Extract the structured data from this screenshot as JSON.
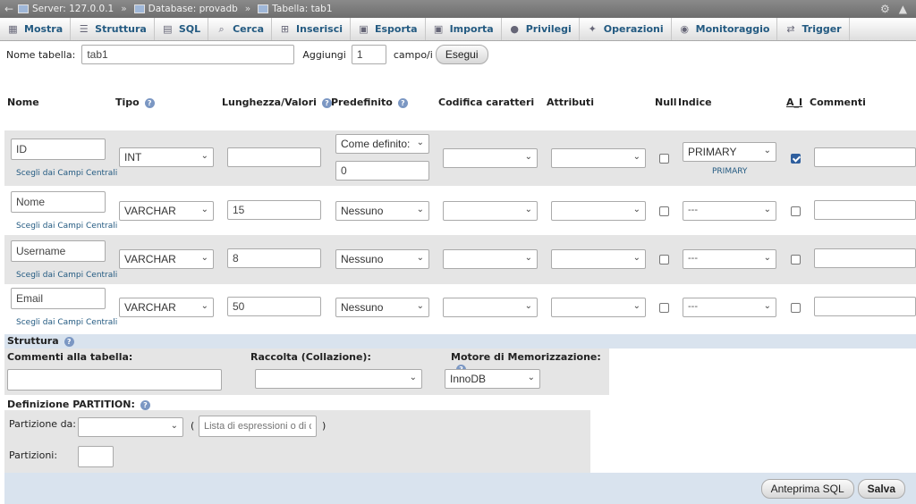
{
  "titlebar": {
    "server": "Server: 127.0.0.1",
    "database": "Database: provadb",
    "table": "Tabella: tab1"
  },
  "tabs": [
    {
      "label": "Mostra",
      "icon": "table-icon"
    },
    {
      "label": "Struttura",
      "icon": "structure-icon"
    },
    {
      "label": "SQL",
      "icon": "sql-icon"
    },
    {
      "label": "Cerca",
      "icon": "search-icon"
    },
    {
      "label": "Inserisci",
      "icon": "insert-icon"
    },
    {
      "label": "Esporta",
      "icon": "export-icon"
    },
    {
      "label": "Importa",
      "icon": "import-icon"
    },
    {
      "label": "Privilegi",
      "icon": "privileges-icon"
    },
    {
      "label": "Operazioni",
      "icon": "wrench-icon"
    },
    {
      "label": "Monitoraggio",
      "icon": "eye-icon"
    },
    {
      "label": "Trigger",
      "icon": "trigger-icon"
    }
  ],
  "namebar": {
    "table_name_label": "Nome tabella:",
    "table_name_value": "tab1",
    "add_label": "Aggiungi",
    "add_value": "1",
    "fields_label": "campo/i",
    "go_button": "Esegui"
  },
  "columns": {
    "name": "Nome",
    "type": "Tipo",
    "length": "Lunghezza/Valori",
    "default": "Predefinito",
    "collation": "Codifica caratteri",
    "attributes": "Attributi",
    "null": "Null",
    "index": "Indice",
    "ai": "A_I",
    "comments": "Commenti"
  },
  "central_columns_link": "Scegli dai Campi Centrali",
  "fields": [
    {
      "name": "ID",
      "type": "INT",
      "length": "",
      "default": "Come definito:",
      "default_value": "0",
      "collation": "",
      "attributes": "",
      "null": false,
      "index": "PRIMARY",
      "index_note": "PRIMARY",
      "ai": true
    },
    {
      "name": "Nome",
      "type": "VARCHAR",
      "length": "15",
      "default": "Nessuno",
      "collation": "",
      "attributes": "",
      "null": false,
      "index": "---",
      "ai": false
    },
    {
      "name": "Username",
      "type": "VARCHAR",
      "length": "8",
      "default": "Nessuno",
      "collation": "",
      "attributes": "",
      "null": false,
      "index": "---",
      "ai": false
    },
    {
      "name": "Email",
      "type": "VARCHAR",
      "length": "50",
      "default": "Nessuno",
      "collation": "",
      "attributes": "",
      "null": false,
      "index": "---",
      "ai": false
    }
  ],
  "structure": {
    "title": "Struttura",
    "table_comments_label": "Commenti alla tabella:",
    "collation_label": "Raccolta (Collazione):",
    "engine_label": "Motore di Memorizzazione:",
    "engine_value": "InnoDB"
  },
  "partition": {
    "title": "Definizione PARTITION:",
    "partition_by_label": "Partizione da:",
    "expression_placeholder": "Lista di espressioni o di car",
    "open_paren": "(",
    "close_paren": ")",
    "partitions_label": "Partizioni:"
  },
  "footer": {
    "preview_button": "Anteprima SQL",
    "save_button": "Salva"
  }
}
